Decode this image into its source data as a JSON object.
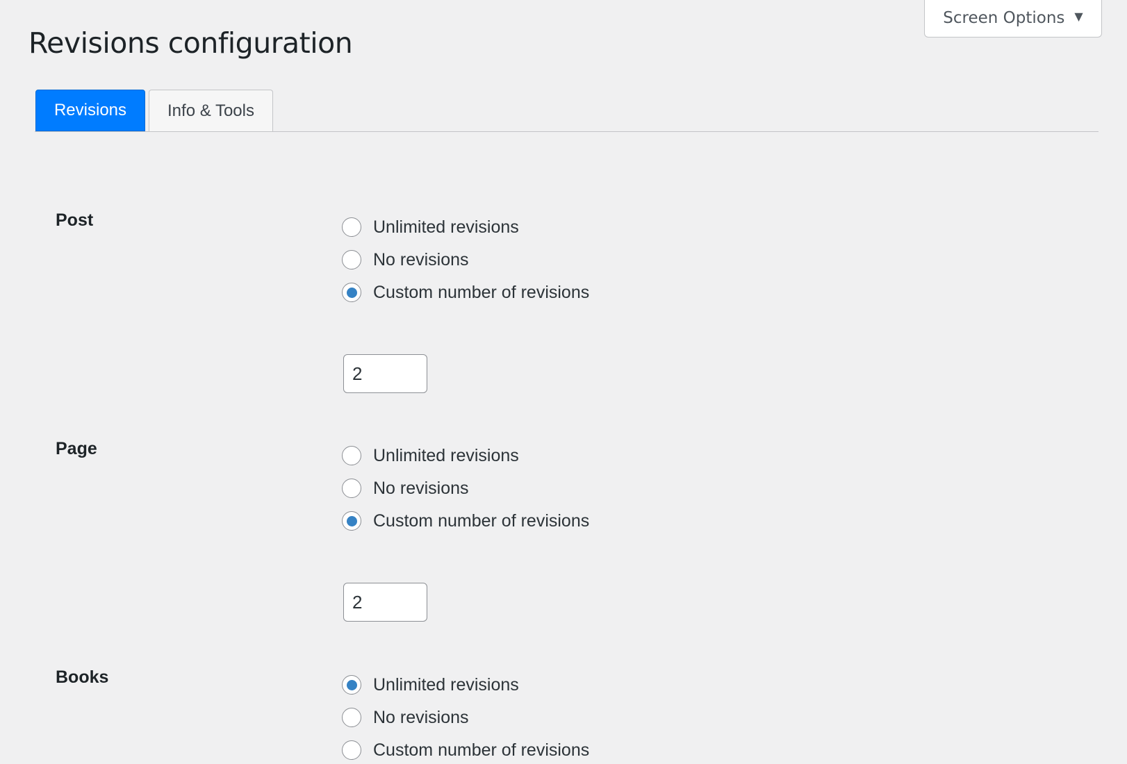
{
  "header": {
    "title": "Revisions configuration",
    "screen_options_label": "Screen Options",
    "screen_options_icon": "triangle-down-icon"
  },
  "tabs": [
    {
      "label": "Revisions",
      "active": true
    },
    {
      "label": "Info & Tools",
      "active": false
    }
  ],
  "sections": [
    {
      "label": "Post",
      "options": [
        "Unlimited revisions",
        "No revisions",
        "Custom number of revisions"
      ],
      "selected": 2,
      "custom_value": "2"
    },
    {
      "label": "Page",
      "options": [
        "Unlimited revisions",
        "No revisions",
        "Custom number of revisions"
      ],
      "selected": 2,
      "custom_value": "2"
    },
    {
      "label": "Books",
      "options": [
        "Unlimited revisions",
        "No revisions",
        "Custom number of revisions"
      ],
      "selected": 0
    }
  ],
  "colors": {
    "accent": "#007cff",
    "radio_checked": "#3582c4",
    "background": "#f0f0f1"
  }
}
